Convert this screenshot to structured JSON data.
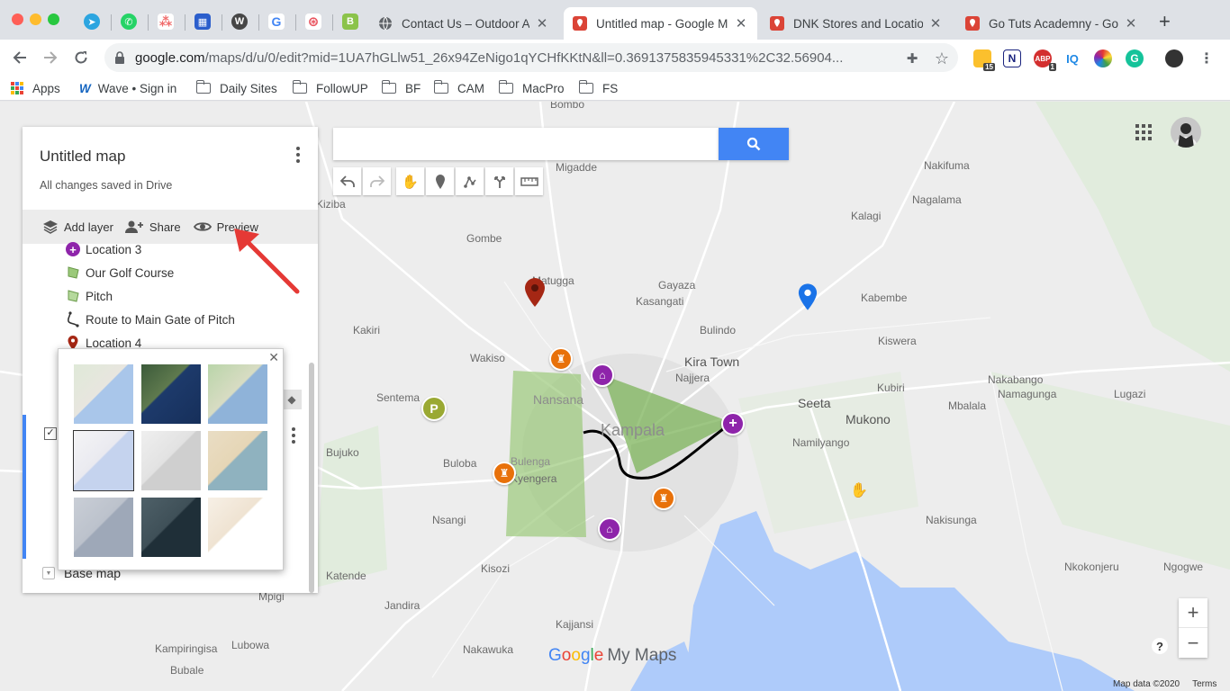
{
  "browser": {
    "pinned_tabs": [
      "telegram-icon",
      "whatsapp-icon",
      "asana-icon",
      "grid-app-icon",
      "wordpress-icon",
      "google-icon",
      "swirl-icon",
      "b-app-icon"
    ],
    "tabs": [
      {
        "title": "Contact Us – Outdoor Ad",
        "favicon": "globe-icon",
        "active": false
      },
      {
        "title": "Untitled map - Google M",
        "favicon": "maps-pin-icon",
        "active": true
      },
      {
        "title": "DNK Stores and Location",
        "favicon": "maps-pin-icon",
        "active": false
      },
      {
        "title": "Go Tuts Academny - Go",
        "favicon": "maps-pin-icon",
        "active": false
      }
    ],
    "url_domain": "google.com",
    "url_rest": "/maps/d/u/0/edit?mid=1UA7hGLlw51_26x94ZeNigo1qYCHfKKtN&ll=0.3691375835945331%2C32.56904...",
    "ext_badge_1": "15",
    "ext_badge_2": "1",
    "ext_iq": "IQ",
    "bookmarks": [
      "Apps",
      "Wave • Sign in",
      "Daily Sites",
      "FollowUP",
      "BF",
      "CAM",
      "MacPro",
      "FS"
    ]
  },
  "panel": {
    "title": "Untitled map",
    "saved": "All changes saved in Drive",
    "actions": {
      "add_layer": "Add layer",
      "share": "Share",
      "preview": "Preview"
    },
    "items": [
      {
        "label": "Location 3",
        "icon": "plus-marker-icon"
      },
      {
        "label": "Our Golf Course",
        "icon": "polygon-icon"
      },
      {
        "label": "Pitch",
        "icon": "polygon-icon"
      },
      {
        "label": "Route to Main Gate of Pitch",
        "icon": "route-icon"
      },
      {
        "label": "Location 4",
        "icon": "pin-icon"
      }
    ],
    "basemap_label": "Base map"
  },
  "map": {
    "places": [
      {
        "name": "Nakifuma"
      },
      {
        "name": "Nagalama"
      },
      {
        "name": "Kalagi"
      },
      {
        "name": "Gombe"
      },
      {
        "name": "Kiziba"
      },
      {
        "name": "Migadde"
      },
      {
        "name": "Matugga"
      },
      {
        "name": "Gayaza"
      },
      {
        "name": "Kasangati"
      },
      {
        "name": "Kabembe"
      },
      {
        "name": "Bulindo"
      },
      {
        "name": "Kiswera"
      },
      {
        "name": "Kakiri"
      },
      {
        "name": "Wakiso"
      },
      {
        "name": "Kira Town"
      },
      {
        "name": "Najjera"
      },
      {
        "name": "Nansana"
      },
      {
        "name": "Kampala"
      },
      {
        "name": "Seeta"
      },
      {
        "name": "Mukono"
      },
      {
        "name": "Kubiri"
      },
      {
        "name": "Namagunga"
      },
      {
        "name": "Lugazi"
      },
      {
        "name": "Nakabango"
      },
      {
        "name": "Mbalala"
      },
      {
        "name": "Namilyango"
      },
      {
        "name": "Sentema"
      },
      {
        "name": "Bujuko"
      },
      {
        "name": "Buloba"
      },
      {
        "name": "Bulenga"
      },
      {
        "name": "Kyengera"
      },
      {
        "name": "Nsangi"
      },
      {
        "name": "Kisozi"
      },
      {
        "name": "Nakisunga"
      },
      {
        "name": "Katende"
      },
      {
        "name": "Nkokonjeru"
      },
      {
        "name": "Ngogwe"
      },
      {
        "name": "Mpigi"
      },
      {
        "name": "Jandira"
      },
      {
        "name": "Kajjansi"
      },
      {
        "name": "Nakawuka"
      },
      {
        "name": "Kampiringisa"
      },
      {
        "name": "Bubale"
      },
      {
        "name": "Bombo"
      },
      {
        "name": "Lubowa"
      }
    ],
    "logo_google": "Google",
    "logo_mymaps": "My Maps",
    "credits": "Map data ©2020",
    "terms": "Terms",
    "zoom_in": "+",
    "zoom_out": "−",
    "help": "?",
    "colors": {
      "primary": "#4285f4",
      "polygon": "#9bc97a",
      "marker_purple": "#8e24aa",
      "marker_orange": "#e8710a",
      "marker_red": "#a52714",
      "marker_blue": "#1a73e8",
      "marker_parking": "#9aa933",
      "water": "#aecbfa"
    }
  }
}
